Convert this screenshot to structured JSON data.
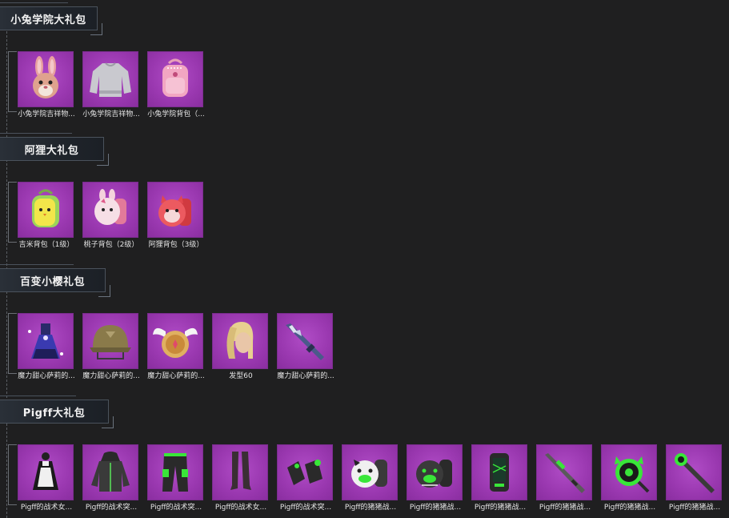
{
  "sections": [
    {
      "title": "小兔学院大礼包",
      "items": [
        {
          "label": "小兔学院吉祥物...",
          "icon": "rabbit-mascot-icon"
        },
        {
          "label": "小兔学院吉祥物...",
          "icon": "sweater-icon"
        },
        {
          "label": "小兔学院背包（...",
          "icon": "pink-backpack-icon"
        }
      ]
    },
    {
      "title": "阿狸大礼包",
      "items": [
        {
          "label": "吉米背包（1级）",
          "icon": "chick-backpack-icon"
        },
        {
          "label": "桃子背包（2级）",
          "icon": "bunny-backpack-icon"
        },
        {
          "label": "阿狸背包（3级）",
          "icon": "fox-backpack-icon"
        }
      ]
    },
    {
      "title": "百变小樱礼包",
      "items": [
        {
          "label": "魔力甜心萨莉的...",
          "icon": "dress-icon"
        },
        {
          "label": "魔力甜心萨莉的...",
          "icon": "helmet-icon"
        },
        {
          "label": "魔力甜心萨莉的...",
          "icon": "winged-shield-icon"
        },
        {
          "label": "发型60",
          "icon": "hairstyle-icon"
        },
        {
          "label": "魔力甜心萨莉的...",
          "icon": "rifle-icon"
        }
      ]
    },
    {
      "title": "Pigff大礼包",
      "items": [
        {
          "label": "Pigff的战术女...",
          "icon": "maid-outfit-icon"
        },
        {
          "label": "Pigff的战术突...",
          "icon": "hoodie-icon"
        },
        {
          "label": "Pigff的战术突...",
          "icon": "tactical-pants-icon"
        },
        {
          "label": "Pigff的战术女...",
          "icon": "stockings-icon"
        },
        {
          "label": "Pigff的战术突...",
          "icon": "gloves-icon"
        },
        {
          "label": "Pigff的猪猪战...",
          "icon": "pig-backpack-icon"
        },
        {
          "label": "Pigff的猪猪战...",
          "icon": "pig-backpack-dark-icon"
        },
        {
          "label": "Pigff的猪猪战...",
          "icon": "phone-case-icon"
        },
        {
          "label": "Pigff的猪猪战...",
          "icon": "sniper-rifle-icon"
        },
        {
          "label": "Pigff的猪猪战...",
          "icon": "pan-icon"
        },
        {
          "label": "Pigff的猪猪战...",
          "icon": "staff-icon"
        }
      ]
    }
  ],
  "colors": {
    "background": "#1f1f20",
    "thumb_purple": "#9a38b0",
    "accent_green": "#39e639",
    "header_bg": "#252a31"
  }
}
